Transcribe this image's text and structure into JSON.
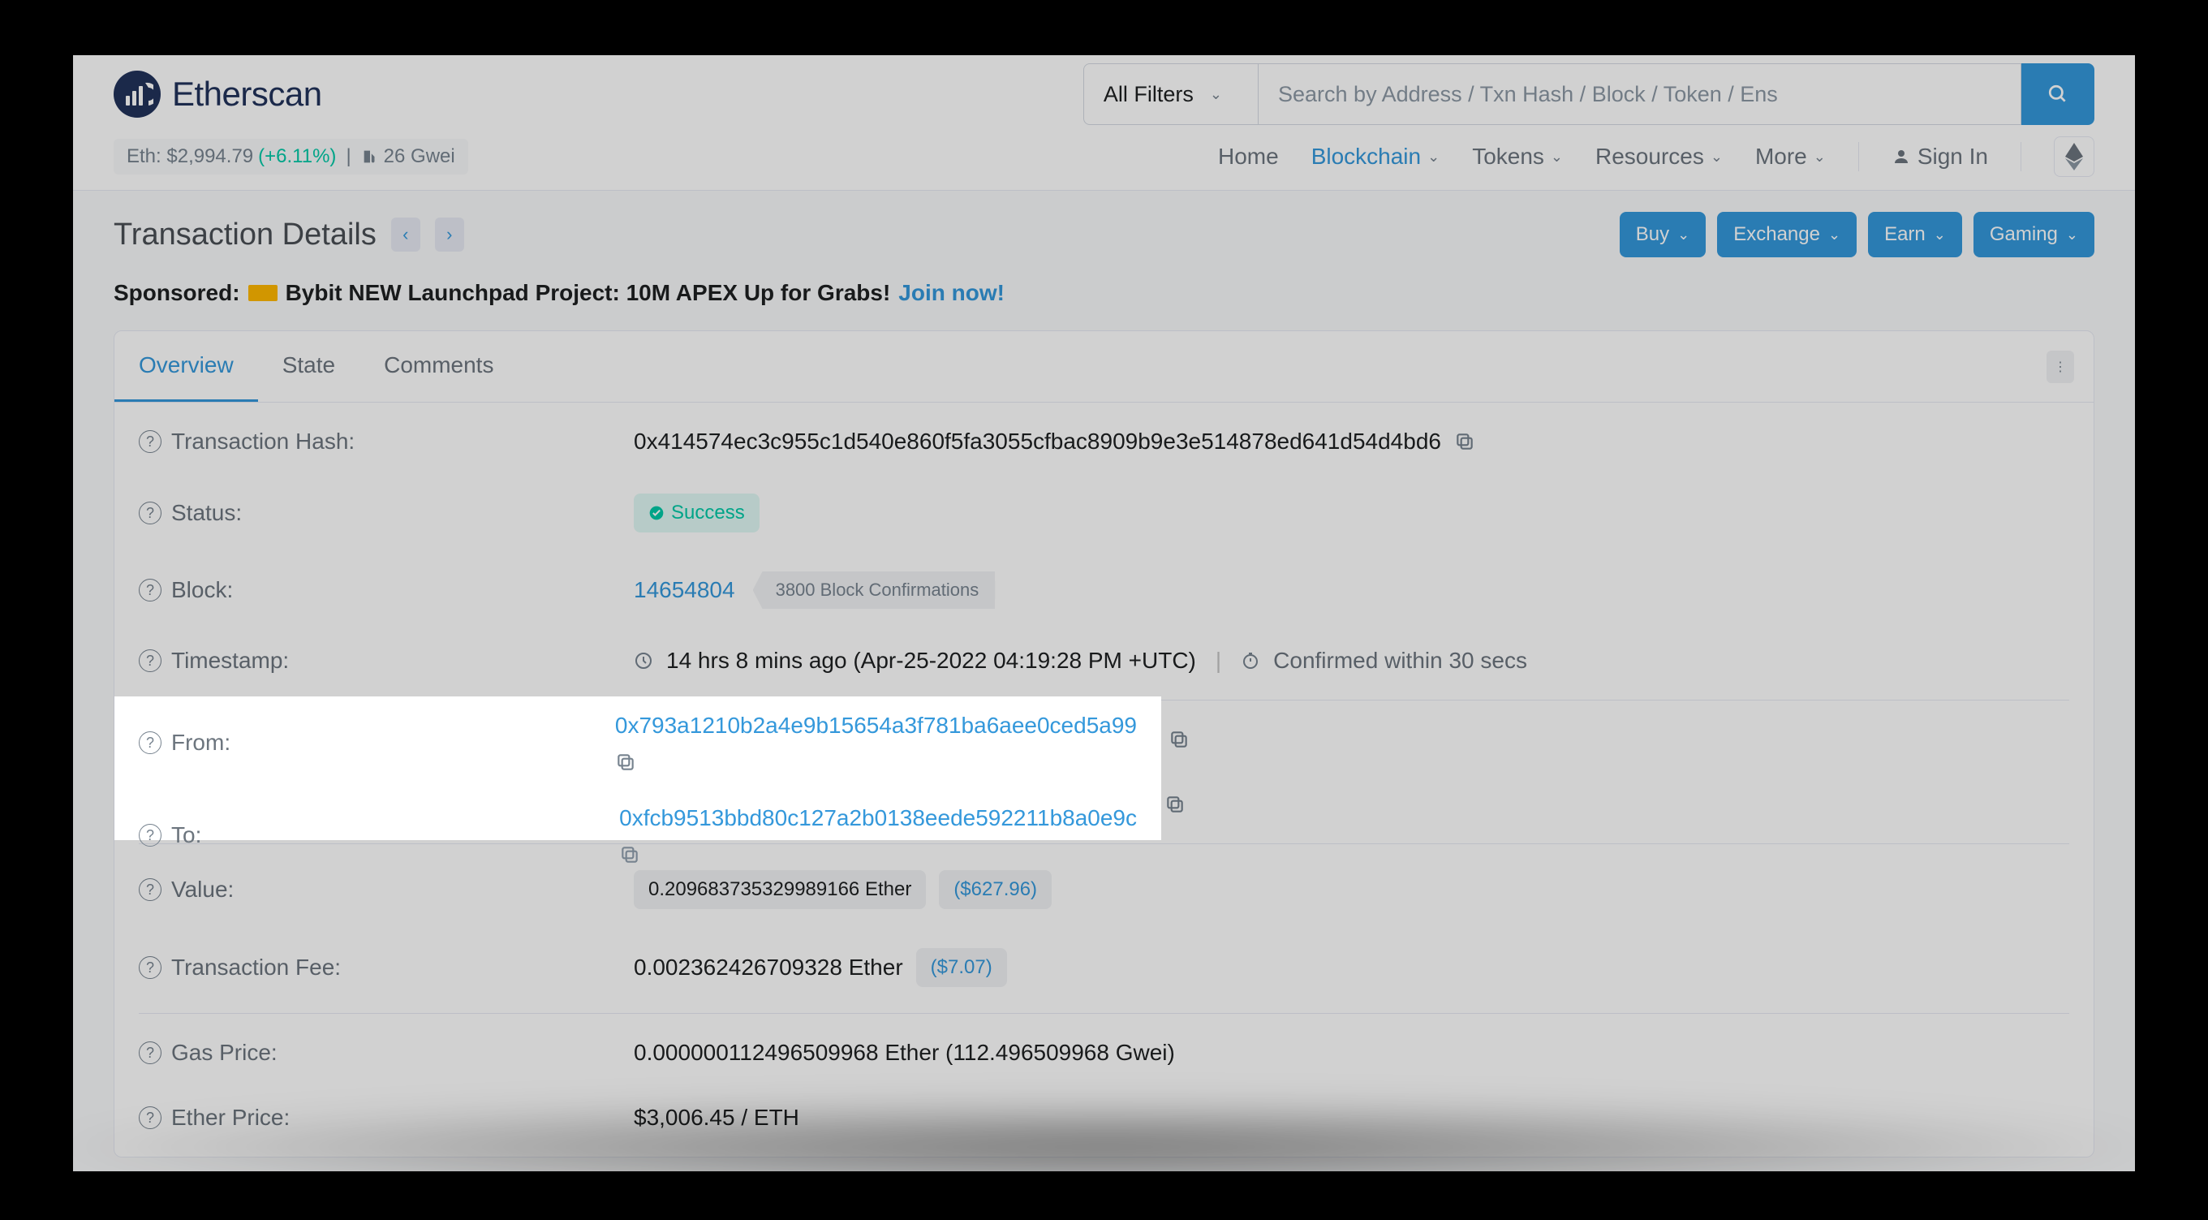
{
  "header": {
    "logo_text": "Etherscan",
    "filter_label": "All Filters",
    "search_placeholder": "Search by Address / Txn Hash / Block / Token / Ens"
  },
  "subheader": {
    "eth_label": "Eth:",
    "eth_price": "$2,994.79",
    "eth_change": "(+6.11%)",
    "gas_text": "26 Gwei"
  },
  "nav": {
    "home": "Home",
    "blockchain": "Blockchain",
    "tokens": "Tokens",
    "resources": "Resources",
    "more": "More",
    "sign_in": "Sign In"
  },
  "page": {
    "title": "Transaction Details"
  },
  "actions": {
    "buy": "Buy",
    "exchange": "Exchange",
    "earn": "Earn",
    "gaming": "Gaming"
  },
  "sponsored": {
    "label": "Sponsored:",
    "text": "Bybit NEW Launchpad Project: 10M APEX Up for Grabs!",
    "link": "Join now!"
  },
  "tabs": {
    "overview": "Overview",
    "state": "State",
    "comments": "Comments"
  },
  "rows": {
    "tx_hash_label": "Transaction Hash:",
    "tx_hash_value": "0x414574ec3c955c1d540e860f5fa3055cfbac8909b9e3e514878ed641d54d4bd6",
    "status_label": "Status:",
    "status_value": "Success",
    "block_label": "Block:",
    "block_value": "14654804",
    "block_conf": "3800 Block Confirmations",
    "timestamp_label": "Timestamp:",
    "timestamp_value": "14 hrs 8 mins ago (Apr-25-2022 04:19:28 PM +UTC)",
    "timestamp_conf": "Confirmed within 30 secs",
    "from_label": "From:",
    "from_value": "0x793a1210b2a4e9b15654a3f781ba6aee0ced5a99",
    "to_label": "To:",
    "to_value": "0xfcb9513bbd80c127a2b0138eede592211b8a0e9c",
    "value_label": "Value:",
    "value_eth": "0.209683735329989166 Ether",
    "value_usd": "($627.96)",
    "fee_label": "Transaction Fee:",
    "fee_eth": "0.002362426709328 Ether",
    "fee_usd": "($7.07)",
    "gas_price_label": "Gas Price:",
    "gas_price_value": "0.000000112496509968 Ether (112.496509968 Gwei)",
    "ether_price_label": "Ether Price:",
    "ether_price_value": "$3,006.45 / ETH"
  }
}
